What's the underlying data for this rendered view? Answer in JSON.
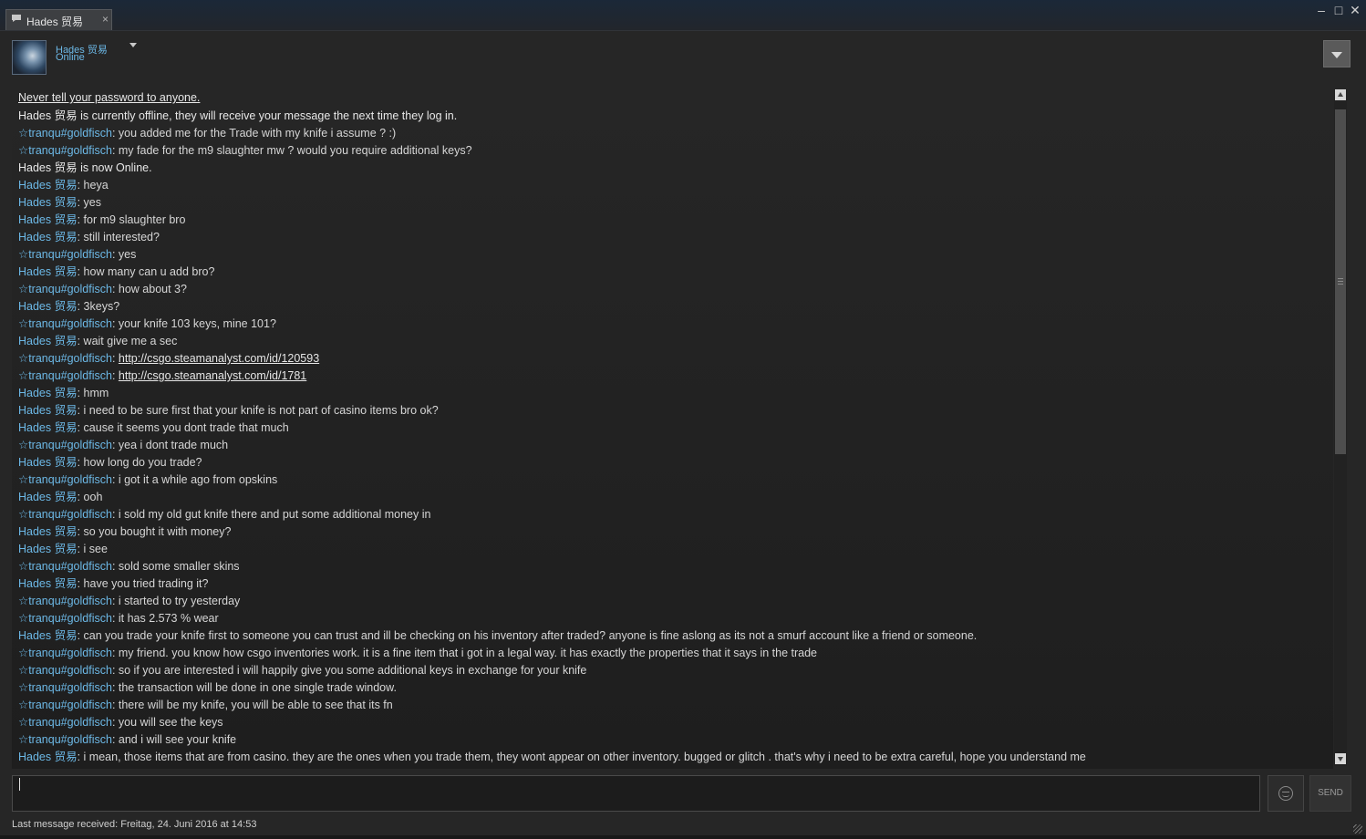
{
  "tab": {
    "label": "Hades 贸易",
    "close": "×"
  },
  "window": {
    "minimize": "–",
    "maximize": "□",
    "close": "✕"
  },
  "friend": {
    "name": "Hades 贸易",
    "status": "Online"
  },
  "chat": {
    "warning": "Never tell your password to anyone.",
    "messages": [
      {
        "type": "sys",
        "text": "Hades 贸易 is currently offline, they will receive your message the next time they log in."
      },
      {
        "type": "msg",
        "who": "☆tranqu#goldfisch",
        "text": ": you added me for the Trade with my knife i assume ? :)"
      },
      {
        "type": "msg",
        "who": "☆tranqu#goldfisch",
        "text": ": my fade for the m9 slaughter mw ? would you require additional keys?"
      },
      {
        "type": "sys",
        "text": "Hades 贸易 is now Online."
      },
      {
        "type": "msg",
        "who": "Hades 贸易",
        "text": ": heya"
      },
      {
        "type": "msg",
        "who": "Hades 贸易",
        "text": ": yes"
      },
      {
        "type": "msg",
        "who": "Hades 贸易",
        "text": ": for m9 slaughter bro"
      },
      {
        "type": "msg",
        "who": "Hades 贸易",
        "text": ": still interested?"
      },
      {
        "type": "msg",
        "who": "☆tranqu#goldfisch",
        "text": ": yes"
      },
      {
        "type": "msg",
        "who": "Hades 贸易",
        "text": ": how many can u add bro?"
      },
      {
        "type": "msg",
        "who": "☆tranqu#goldfisch",
        "text": ": how about 3?"
      },
      {
        "type": "msg",
        "who": "Hades 贸易",
        "text": ": 3keys?"
      },
      {
        "type": "msg",
        "who": "☆tranqu#goldfisch",
        "text": ": your knife 103 keys, mine 101?"
      },
      {
        "type": "msg",
        "who": "Hades 贸易",
        "text": ": wait give me a sec"
      },
      {
        "type": "link",
        "who": "☆tranqu#goldfisch",
        "text": ": ",
        "link": "http://csgo.steamanalyst.com/id/120593"
      },
      {
        "type": "link",
        "who": "☆tranqu#goldfisch",
        "text": ": ",
        "link": "http://csgo.steamanalyst.com/id/1781"
      },
      {
        "type": "msg",
        "who": "Hades 贸易",
        "text": ": hmm"
      },
      {
        "type": "msg",
        "who": "Hades 贸易",
        "text": ": i need to be sure first that your knife is not part of casino items bro ok?"
      },
      {
        "type": "msg",
        "who": "Hades 贸易",
        "text": ": cause it seems you dont trade that much"
      },
      {
        "type": "msg",
        "who": "☆tranqu#goldfisch",
        "text": ": yea i dont trade much"
      },
      {
        "type": "msg",
        "who": "Hades 贸易",
        "text": ": how long do you trade?"
      },
      {
        "type": "msg",
        "who": "☆tranqu#goldfisch",
        "text": ": i got it a while ago from opskins"
      },
      {
        "type": "msg",
        "who": "Hades 贸易",
        "text": ": ooh"
      },
      {
        "type": "msg",
        "who": "☆tranqu#goldfisch",
        "text": ": i sold my old gut knife there and put some additional money in"
      },
      {
        "type": "msg",
        "who": "Hades 贸易",
        "text": ": so you bought it with money?"
      },
      {
        "type": "msg",
        "who": "Hades 贸易",
        "text": ": i see"
      },
      {
        "type": "msg",
        "who": "☆tranqu#goldfisch",
        "text": ": sold some smaller skins"
      },
      {
        "type": "msg",
        "who": "Hades 贸易",
        "text": ": have you tried trading it?"
      },
      {
        "type": "msg",
        "who": "☆tranqu#goldfisch",
        "text": ": i started to try yesterday"
      },
      {
        "type": "msg",
        "who": "☆tranqu#goldfisch",
        "text": ": it has 2.573 % wear"
      },
      {
        "type": "msg",
        "who": "Hades 贸易",
        "text": ": can you trade your knife first to someone you can trust and ill be checking on his inventory after traded? anyone is fine aslong as its not a smurf account like a friend or someone."
      },
      {
        "type": "msg",
        "who": "☆tranqu#goldfisch",
        "text": ": my friend. you know how csgo inventories work. it is a fine item that i got in a legal way. it has exactly the properties that it says in the trade"
      },
      {
        "type": "msg",
        "who": "☆tranqu#goldfisch",
        "text": ": so if you are interested i will happily give you some additional keys in exchange for your knife"
      },
      {
        "type": "msg",
        "who": "☆tranqu#goldfisch",
        "text": ": the transaction will be done in one single trade window."
      },
      {
        "type": "msg",
        "who": "☆tranqu#goldfisch",
        "text": ": there will be my knife, you will be able to see that its fn"
      },
      {
        "type": "msg",
        "who": "☆tranqu#goldfisch",
        "text": ": you will see the keys"
      },
      {
        "type": "msg",
        "who": "☆tranqu#goldfisch",
        "text": ": and i will see your knife"
      },
      {
        "type": "msg",
        "who": "Hades 贸易",
        "text": ": i mean, those items that are from casino. they are the ones when you trade them, they wont appear on other inventory. bugged or glitch . that's why i need to be extra careful, hope you understand me"
      }
    ]
  },
  "input": {
    "value": ""
  },
  "send_label": "SEND",
  "footer": "Last message received: Freitag, 24. Juni 2016 at 14:53",
  "icons": {
    "tab": "chat-bubble-icon",
    "emoticon": "smiley-face-icon",
    "dropdown": "chevron-down-icon"
  },
  "colors": {
    "name": "#6cb8e6",
    "background": "#262626",
    "text": "#d6d6d6"
  }
}
